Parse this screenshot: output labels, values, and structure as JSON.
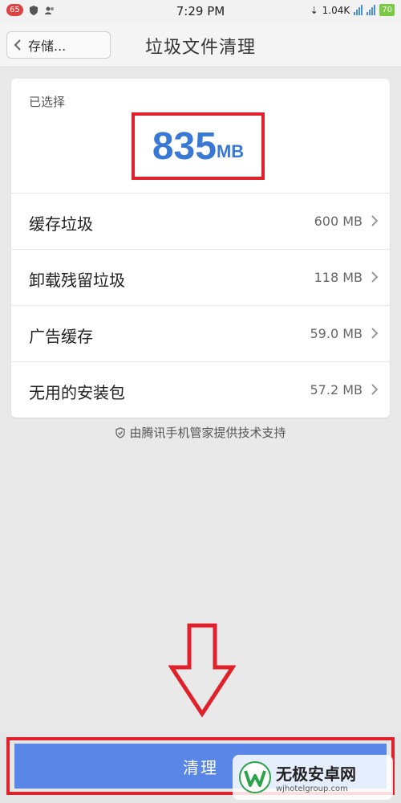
{
  "status_bar": {
    "notification_count": "65",
    "time": "7:29 PM",
    "speed": "1.04K",
    "battery": "70"
  },
  "header": {
    "back_label": "存储...",
    "title": "垃圾文件清理"
  },
  "summary": {
    "label": "已选择",
    "size_value": "835",
    "size_unit": "MB"
  },
  "items": [
    {
      "label": "缓存垃圾",
      "value": "600 MB"
    },
    {
      "label": "卸载残留垃圾",
      "value": "118 MB"
    },
    {
      "label": "广告缓存",
      "value": "59.0 MB"
    },
    {
      "label": "无用的安装包",
      "value": "57.2 MB"
    }
  ],
  "footer_note": "由腾讯手机管家提供技术支持",
  "clean_button": "清理",
  "watermark": {
    "title": "无极安卓网",
    "url": "wjhotelgroup.com"
  },
  "colors": {
    "accent": "#3a78d6",
    "button": "#5a86e8",
    "annotation": "#e0202a"
  }
}
